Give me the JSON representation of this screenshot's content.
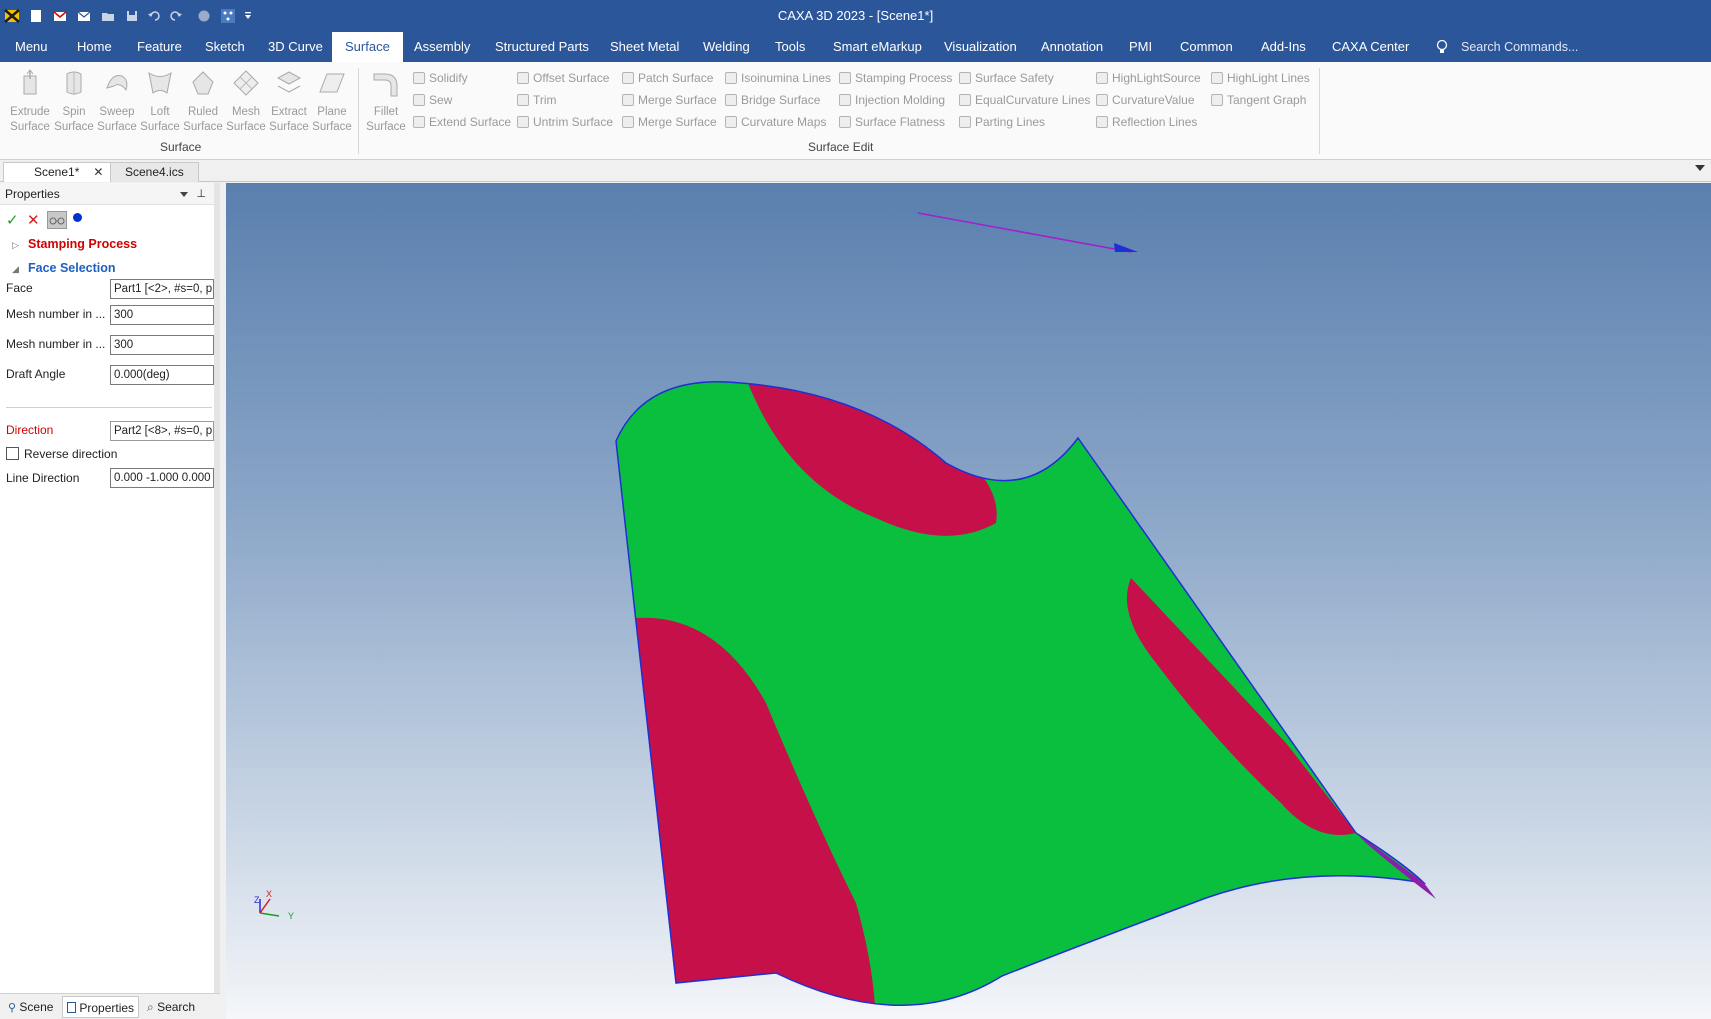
{
  "window": {
    "title": "CAXA 3D 2023 - [Scene1*]"
  },
  "quick_access": {
    "icons": [
      "app-logo-icon",
      "new-file-icon",
      "open-file-icon",
      "mail-icon",
      "open-folder-icon",
      "save-icon",
      "undo-icon",
      "redo-icon",
      "globe-icon",
      "customize-icon",
      "dropdown-arrow-icon"
    ]
  },
  "menu": {
    "tabs": [
      "Menu",
      "Home",
      "Feature",
      "Sketch",
      "3D Curve",
      "Surface",
      "Assembly",
      "Structured Parts",
      "Sheet Metal",
      "Welding",
      "Tools",
      "Smart eMarkup",
      "Visualization",
      "Annotation",
      "PMI",
      "Common",
      "Add-Ins",
      "CAXA Center"
    ],
    "active": "Surface",
    "search_placeholder": "Search Commands..."
  },
  "ribbon": {
    "surface_group": {
      "label": "Surface",
      "buttons": [
        {
          "line1": "Extrude",
          "line2": "Surface"
        },
        {
          "line1": "Spin",
          "line2": "Surface"
        },
        {
          "line1": "Sweep",
          "line2": "Surface"
        },
        {
          "line1": "Loft",
          "line2": "Surface"
        },
        {
          "line1": "Ruled",
          "line2": "Surface"
        },
        {
          "line1": "Mesh",
          "line2": "Surface"
        },
        {
          "line1": "Extract",
          "line2": "Surface"
        },
        {
          "line1": "Plane",
          "line2": "Surface"
        }
      ]
    },
    "surface_edit_group": {
      "label": "Surface Edit",
      "fillet": {
        "line1": "Fillet",
        "line2": "Surface"
      },
      "columns": [
        [
          "Solidify",
          "Sew",
          "Extend Surface"
        ],
        [
          "Offset Surface",
          "Trim",
          "Untrim Surface"
        ],
        [
          "Patch Surface",
          "Merge Surface",
          "Merge Surface"
        ],
        [
          "Isoinumina Lines",
          "Bridge Surface",
          "Curvature Maps"
        ],
        [
          "Stamping Process",
          "Injection Molding",
          "Surface Flatness"
        ],
        [
          "Surface Safety",
          "EqualCurvature Lines",
          "Parting Lines"
        ],
        [
          "HighLightSource",
          "CurvatureValue",
          "Reflection Lines"
        ],
        [
          "HighLight Lines",
          "Tangent Graph"
        ]
      ]
    }
  },
  "doc_tabs": [
    {
      "label": "Scene1*",
      "active": true,
      "closable": true
    },
    {
      "label": "Scene4.ics",
      "active": false,
      "closable": false
    }
  ],
  "properties": {
    "title": "Properties",
    "sections": {
      "stamping": "Stamping Process",
      "face_selection": "Face Selection"
    },
    "fields": {
      "face_label": "Face",
      "face_value": "Part1 [<2>, #s=0, p",
      "mesh1_label": "Mesh number in ...",
      "mesh1_value": "300",
      "mesh2_label": "Mesh number in ...",
      "mesh2_value": "300",
      "draft_label": "Draft Angle",
      "draft_value": "0.000(deg)",
      "direction_label": "Direction",
      "direction_value": "Part2 [<8>, #s=0, p",
      "reverse_label": "Reverse direction",
      "reverse_checked": false,
      "line_dir_label": "Line Direction",
      "line_dir_value": "0.000  -1.000  0.000"
    }
  },
  "bottom_tabs": [
    "Scene",
    "Properties",
    "Search"
  ],
  "bottom_active": "Properties",
  "viewport": {
    "axis_labels": {
      "x": "X",
      "y": "Y",
      "z": "Z"
    },
    "colors": {
      "safe": "#0bbf3e",
      "unsafe": "#c5104a",
      "edge": "#1f2fd6",
      "direction_line": "#a01fd0",
      "direction_arrow": "#1f2fd6"
    }
  },
  "colors": {
    "title_bar": "#2b579a",
    "section_red": "#d40000",
    "section_blue": "#1f5fc0",
    "ribbon_disabled": "#9a9a9a"
  }
}
